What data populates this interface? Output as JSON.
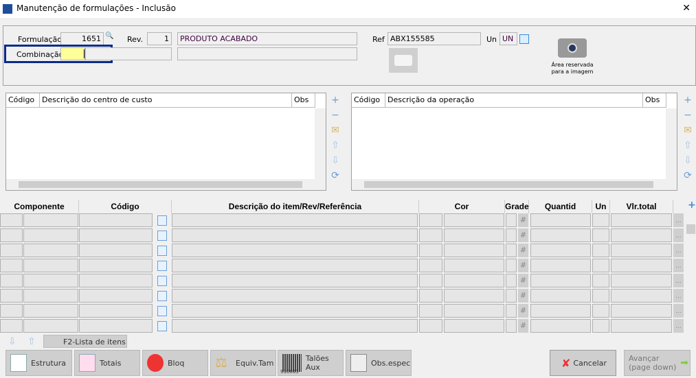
{
  "window": {
    "title": "Manutenção de formulações - Inclusão",
    "close": "✕"
  },
  "header": {
    "formulacao_label": "Formulação",
    "formulacao_value": "1651",
    "rev_label": "Rev.",
    "rev_value": "1",
    "descricao": "PRODUTO ACABADO",
    "combinacao_label": "Combinação",
    "combinacao_value": "",
    "ref_label": "Ref",
    "ref_value": "ABX155585",
    "un_label": "Un",
    "un_value": "UN",
    "image_area_line1": "Área reservada",
    "image_area_line2": "para a imagem"
  },
  "cost_center_grid": {
    "columns": [
      "Código",
      "Descrição do centro de custo",
      "Obs"
    ]
  },
  "operation_grid": {
    "columns": [
      "Código",
      "Descrição da operação",
      "Obs"
    ]
  },
  "items_grid": {
    "columns": [
      "Componente",
      "Código",
      "Descrição do item/Rev/Referência",
      "Cor",
      "Grade",
      "Quantid",
      "Un",
      "Vlr.total"
    ],
    "row_count": 8,
    "grade_symbol": "#",
    "more_symbol": "..."
  },
  "bottom": {
    "list_button": "F2-Lista de itens",
    "buttons": [
      "Estrutura",
      "Totais",
      "Bloq",
      "Equiv.Tam",
      "Talões Aux",
      "Obs.espec"
    ],
    "barcode_text": "930063",
    "cancel": "Cancelar",
    "next_line1": "Avançar",
    "next_line2": "(page down)"
  },
  "colors": {
    "focus_border": "#0a2a8a",
    "active_input": "#ffff99",
    "icon_blue": "#3c8ad8"
  }
}
